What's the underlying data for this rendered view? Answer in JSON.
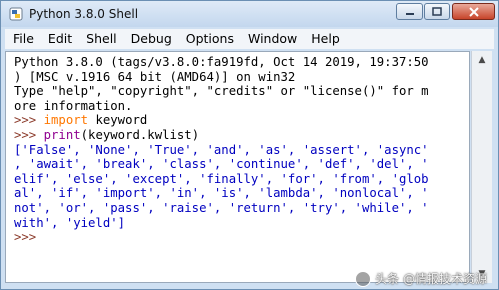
{
  "window": {
    "title": "Python 3.8.0 Shell",
    "controls": {
      "minimize_glyph": "—",
      "maximize_glyph": "▢",
      "close_glyph": "✕"
    }
  },
  "menu": [
    "File",
    "Edit",
    "Shell",
    "Debug",
    "Options",
    "Window",
    "Help"
  ],
  "shell": {
    "prompt": ">>>",
    "banner": [
      "Python 3.8.0 (tags/v3.8.0:fa919fd, Oct 14 2019, 19:37:50",
      ") [MSC v.1916 64 bit (AMD64)] on win32",
      "Type \"help\", \"copyright\", \"credits\" or \"license()\" for m",
      "ore information."
    ],
    "cmd1_keyword": "import",
    "cmd1_rest": " keyword",
    "cmd2_builtin": "print",
    "cmd2_rest": "(keyword.kwlist)",
    "output": [
      "['False', 'None', 'True', 'and', 'as', 'assert', 'async'",
      ", 'await', 'break', 'class', 'continue', 'def', 'del', '",
      "elif', 'else', 'except', 'finally', 'for', 'from', 'glob",
      "al', 'if', 'import', 'in', 'is', 'lambda', 'nonlocal', '",
      "not', 'or', 'pass', 'raise', 'return', 'try', 'while', '",
      "with', 'yield']"
    ]
  },
  "watermark": "头条 @情报技术资源",
  "colors": {
    "prompt": "#8b3a2a",
    "keyword": "#ff7700",
    "builtin": "#900090",
    "output": "#0000c0"
  },
  "icons": {
    "app": "python-idle-icon",
    "scroll_up": "arrow-up-icon",
    "scroll_down": "arrow-down-icon"
  }
}
